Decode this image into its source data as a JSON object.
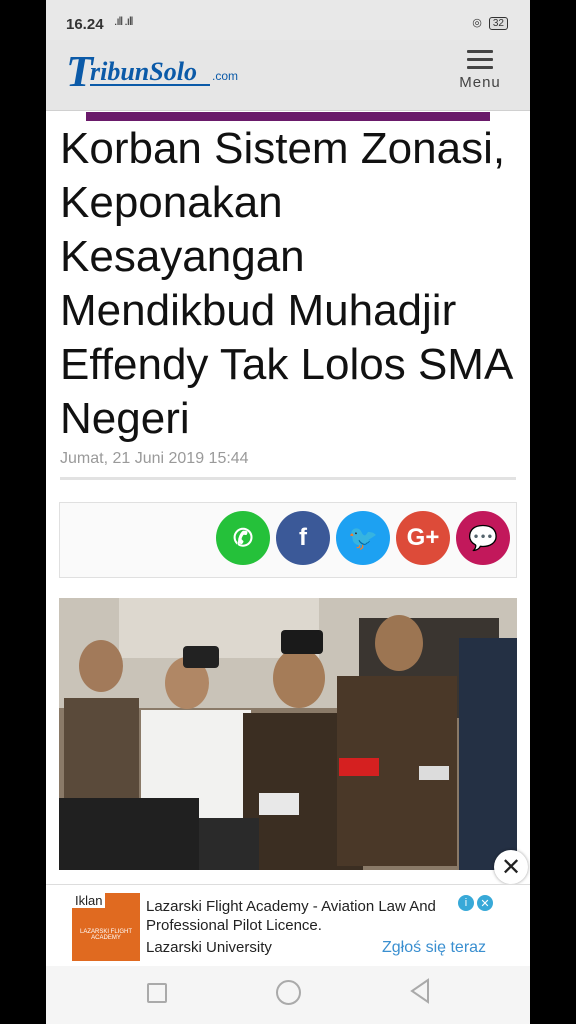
{
  "status_bar": {
    "time": "16.24",
    "signal": ".ıll .ıll",
    "battery": "32"
  },
  "header": {
    "logo_main": "TribunSolo",
    "logo_suffix": ".com",
    "menu_label": "Menu"
  },
  "article": {
    "title": "Korban Sistem Zonasi, Keponakan Kesayangan Mendikbud Muhadjir Effendy Tak Lolos SMA Negeri",
    "date": "Jumat, 21 Juni 2019 15:44"
  },
  "share": [
    {
      "name": "whatsapp-icon",
      "glyph": "✆",
      "color": "#25c13a"
    },
    {
      "name": "facebook-icon",
      "glyph": "f",
      "color": "#3b5998"
    },
    {
      "name": "twitter-icon",
      "glyph": "🐦",
      "color": "#1da1f2"
    },
    {
      "name": "google-plus-icon",
      "glyph": "G+",
      "color": "#dd4b39"
    },
    {
      "name": "comment-icon",
      "glyph": "💬",
      "color": "#c2185b"
    }
  ],
  "ad": {
    "tag": "Iklan",
    "thumb_text": "LAZARSKI FLIGHT ACADEMY",
    "title": "Lazarski Flight Academy - Aviation Law And Professional Pilot Licence.",
    "brand": "Lazarski University",
    "cta": "Zgłoś się teraz"
  }
}
